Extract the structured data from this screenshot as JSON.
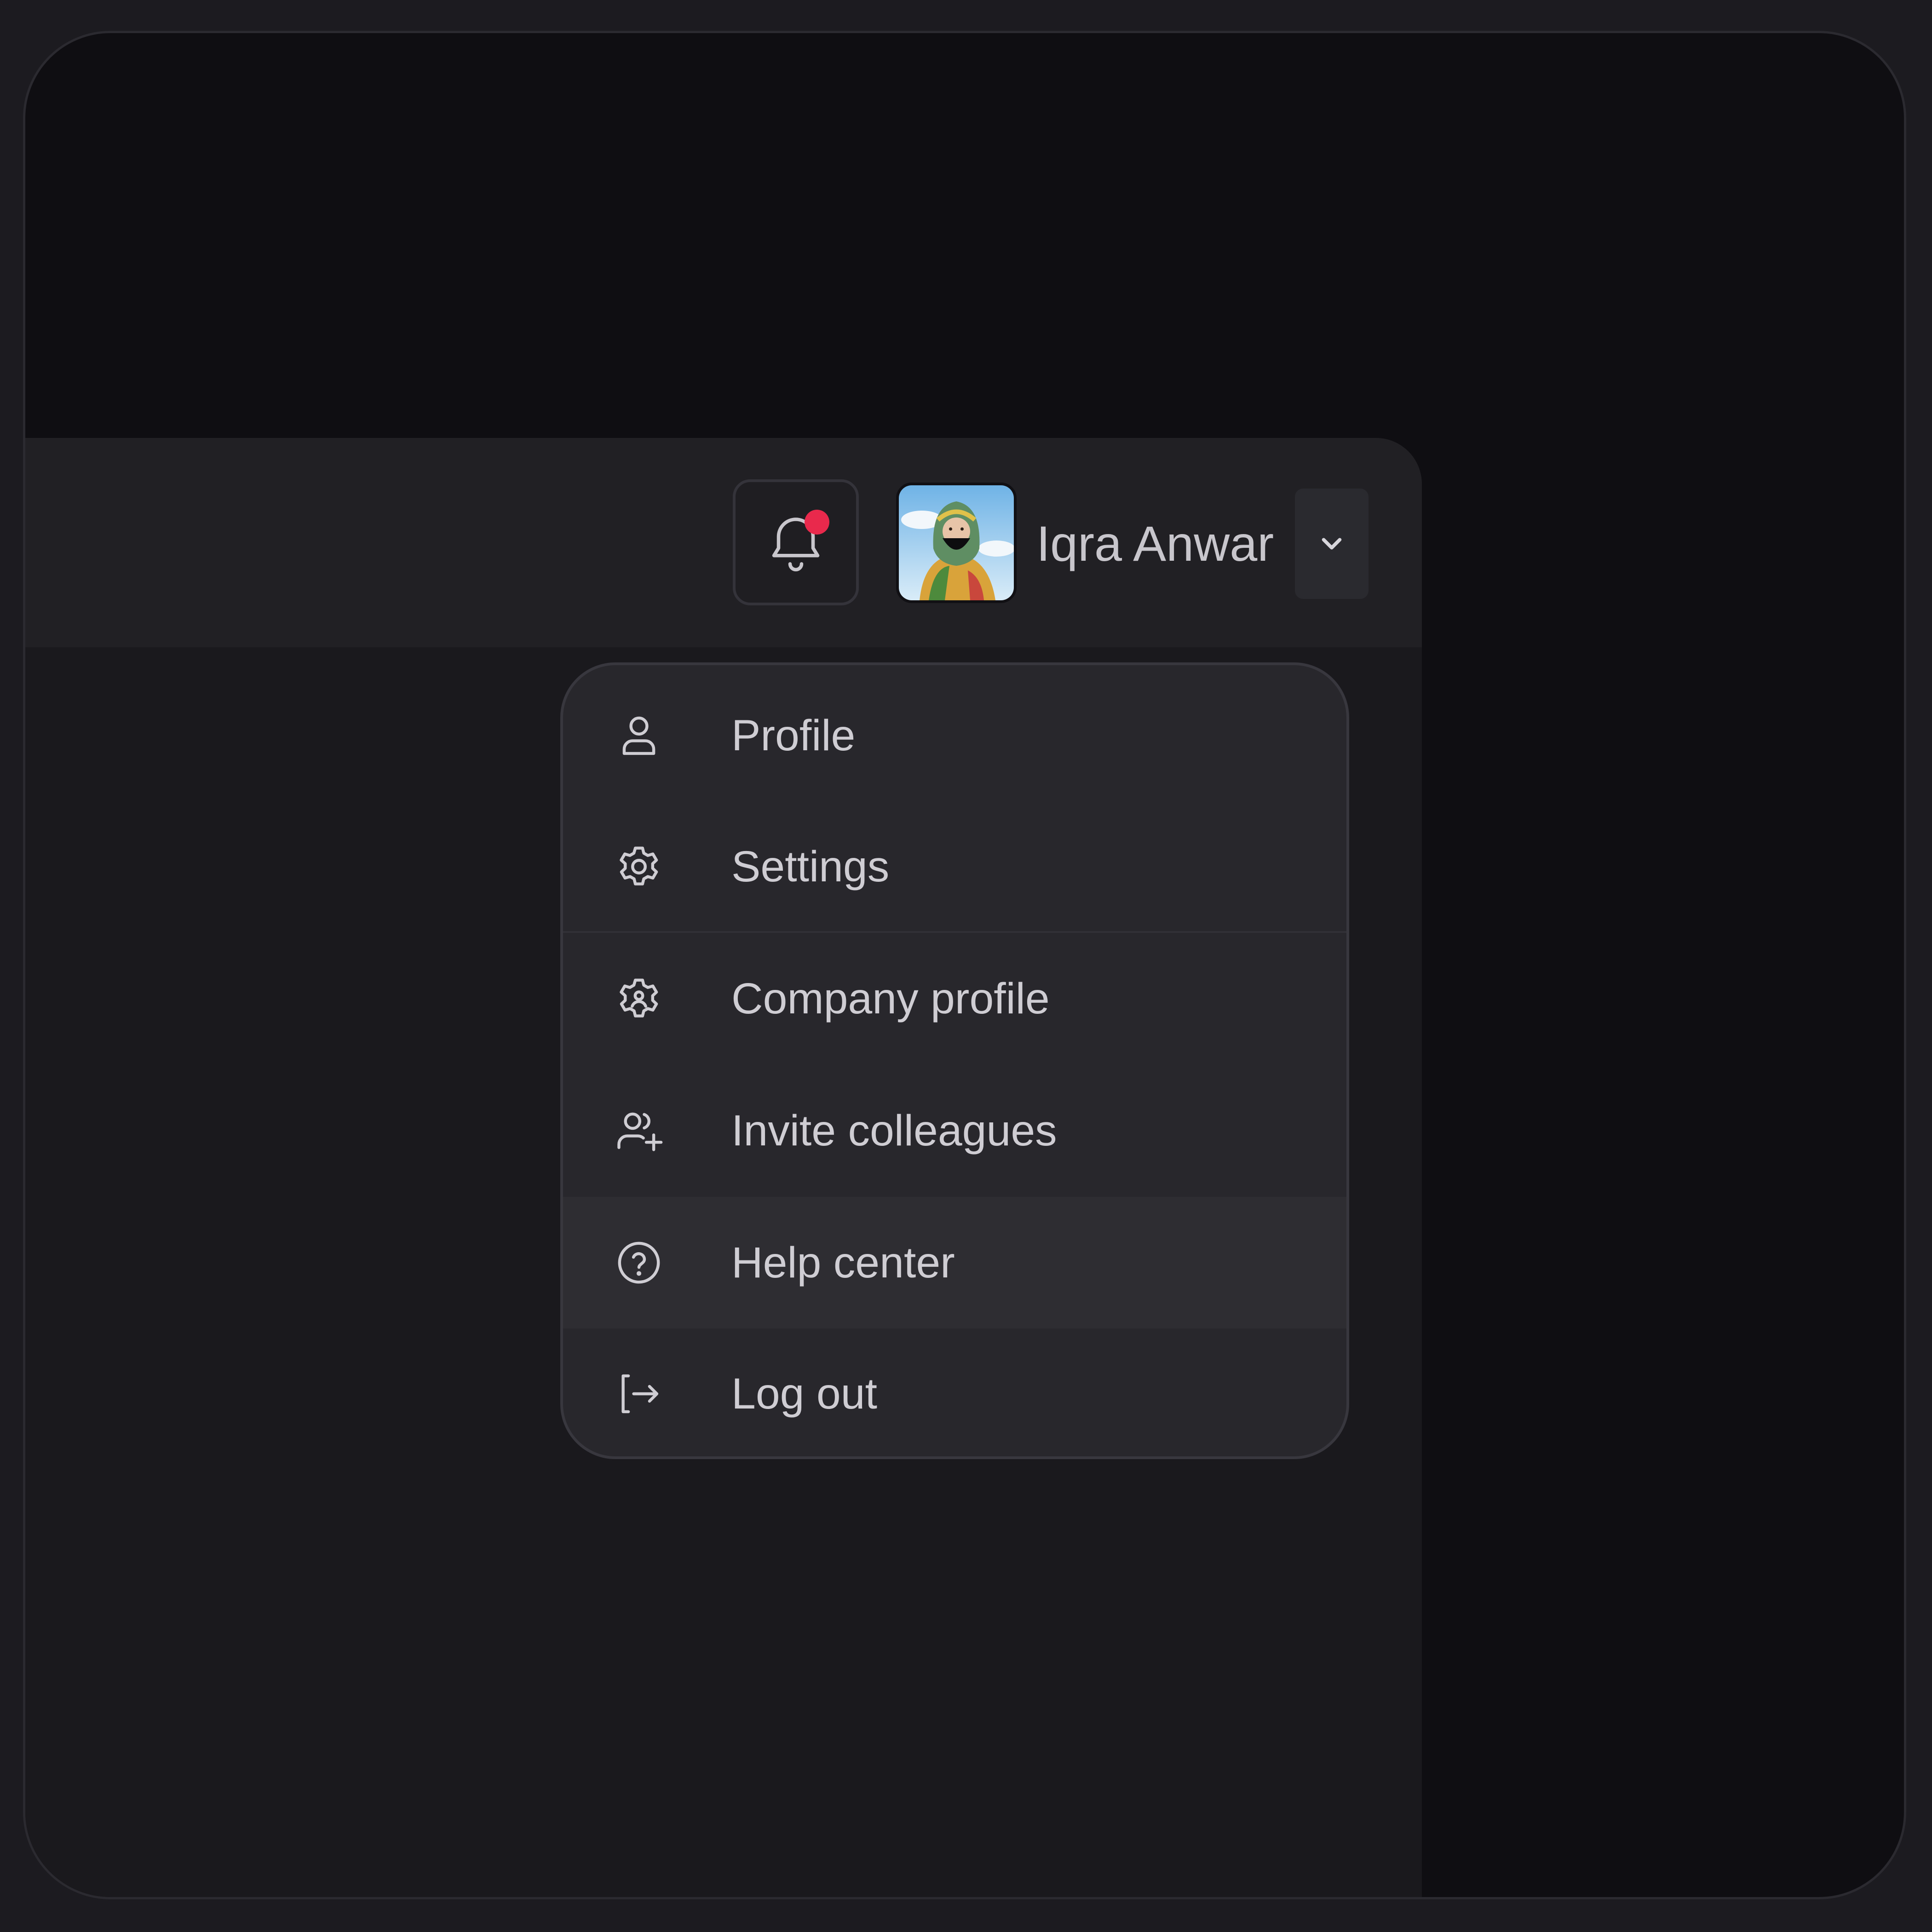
{
  "header": {
    "notification_icon": "bell-icon",
    "notification_badge_color": "#e9294c",
    "user": {
      "name": "Iqra Anwar",
      "avatar": "user-avatar-photo"
    },
    "dropdown_icon": "chevron-down-icon"
  },
  "menu": {
    "items": [
      {
        "label": "Profile",
        "icon": "user-icon"
      },
      {
        "label": "Settings",
        "icon": "gear-icon"
      },
      {
        "label": "Company profile",
        "icon": "company-badge-icon"
      },
      {
        "label": "Invite colleagues",
        "icon": "users-plus-icon"
      },
      {
        "label": "Help center",
        "icon": "help-circle-icon",
        "highlighted": true
      },
      {
        "label": "Log out",
        "icon": "logout-icon"
      }
    ]
  }
}
